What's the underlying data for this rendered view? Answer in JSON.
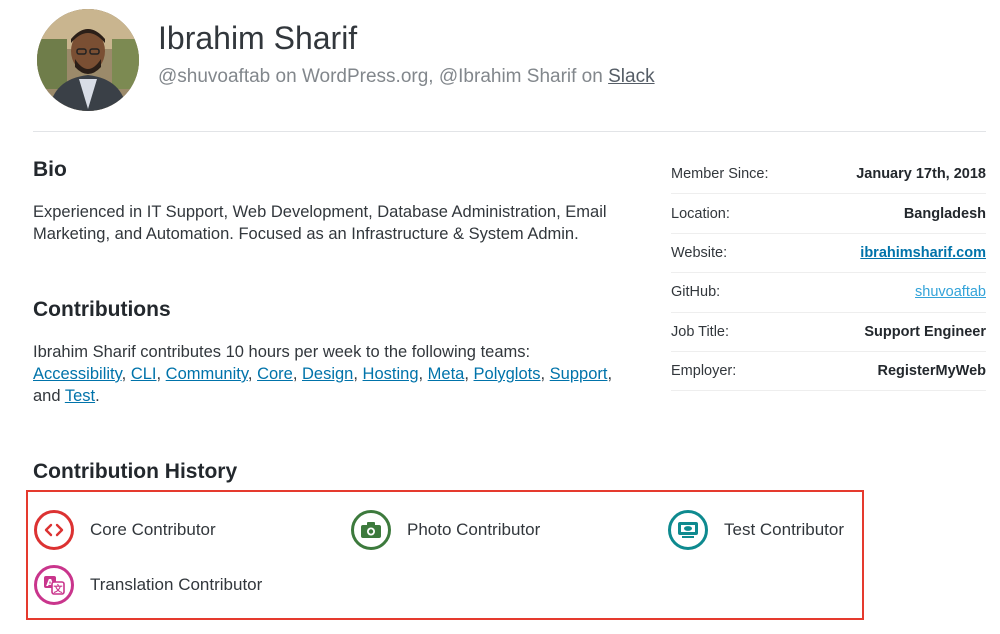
{
  "profile": {
    "name": "Ibrahim Sharif",
    "handles_prefix": "@shuvoaftab on WordPress.org, @Ibrahim Sharif on ",
    "slack_link": "Slack"
  },
  "bio": {
    "title": "Bio",
    "text": "Experienced in IT Support, Web Development, Database Administration, Email Marketing, and Automation. Focused as an Infrastructure & System Admin."
  },
  "contributions": {
    "title": "Contributions",
    "intro": "Ibrahim Sharif contributes 10 hours per week to the following teams:",
    "teams": [
      "Accessibility",
      "CLI",
      "Community",
      "Core",
      "Design",
      "Hosting",
      "Meta",
      "Polyglots",
      "Support"
    ],
    "and_text": "and",
    "last_team": "Test"
  },
  "meta": {
    "rows": [
      {
        "label": "Member Since:",
        "value": "January 17th, 2018"
      },
      {
        "label": "Location:",
        "value": "Bangladesh"
      },
      {
        "label": "Website:",
        "value": "ibrahimsharif.com"
      },
      {
        "label": "GitHub:",
        "value": "shuvoaftab"
      },
      {
        "label": "Job Title:",
        "value": "Support Engineer"
      },
      {
        "label": "Employer:",
        "value": "RegisterMyWeb"
      }
    ]
  },
  "history": {
    "title": "Contribution History",
    "badges": [
      {
        "label": "Core Contributor",
        "icon": "code-icon",
        "color": "#dc3232"
      },
      {
        "label": "Photo Contributor",
        "icon": "camera-icon",
        "color": "#3d7a3d"
      },
      {
        "label": "Test Contributor",
        "icon": "screen-icon",
        "color": "#0e8a8f"
      },
      {
        "label": "Translation Contributor",
        "icon": "translation-icon",
        "color": "#c9358c"
      }
    ]
  }
}
